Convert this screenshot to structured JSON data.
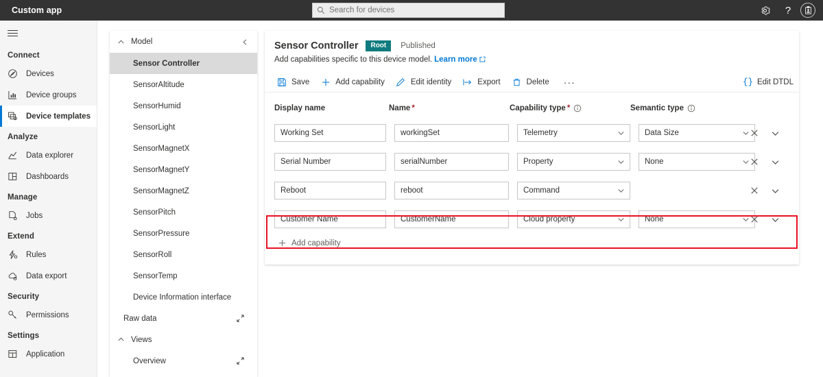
{
  "topbar": {
    "app_title": "Custom app",
    "search": {
      "placeholder": "Search for devices",
      "value": "",
      "icon": "search-icon"
    },
    "settings_icon": "gear-icon",
    "help_icon": "question-mark-icon",
    "account_icon": "account-badge-icon"
  },
  "sidebar": {
    "menu_icon": "hamburger-menu-icon",
    "groups": [
      {
        "label": "Connect",
        "items": [
          {
            "label": "Devices",
            "icon": "devices-icon",
            "selected": false
          },
          {
            "label": "Device groups",
            "icon": "device-groups-icon",
            "selected": false
          },
          {
            "label": "Device templates",
            "icon": "device-templates-icon",
            "selected": true
          }
        ]
      },
      {
        "label": "Analyze",
        "items": [
          {
            "label": "Data explorer",
            "icon": "line-chart-icon",
            "selected": false
          },
          {
            "label": "Dashboards",
            "icon": "dashboard-grid-icon",
            "selected": false
          }
        ]
      },
      {
        "label": "Manage",
        "items": [
          {
            "label": "Jobs",
            "icon": "jobs-document-icon",
            "selected": false
          }
        ]
      },
      {
        "label": "Extend",
        "items": [
          {
            "label": "Rules",
            "icon": "rules-icon",
            "selected": false
          },
          {
            "label": "Data export",
            "icon": "cloud-export-icon",
            "selected": false
          }
        ]
      },
      {
        "label": "Security",
        "items": [
          {
            "label": "Permissions",
            "icon": "key-icon",
            "selected": false
          }
        ]
      },
      {
        "label": "Settings",
        "items": [
          {
            "label": "Application",
            "icon": "application-grid-icon",
            "selected": false
          }
        ]
      }
    ]
  },
  "tree": {
    "model_header": {
      "label": "Model",
      "chevron": "chevron-up-icon",
      "collapse_icon": "chevron-left-icon"
    },
    "items": [
      {
        "label": "Sensor Controller",
        "selected": true,
        "expand": false
      },
      {
        "label": "SensorAltitude",
        "selected": false,
        "expand": false
      },
      {
        "label": "SensorHumid",
        "selected": false,
        "expand": false
      },
      {
        "label": "SensorLight",
        "selected": false,
        "expand": false
      },
      {
        "label": "SensorMagnetX",
        "selected": false,
        "expand": false
      },
      {
        "label": "SensorMagnetY",
        "selected": false,
        "expand": false
      },
      {
        "label": "SensorMagnetZ",
        "selected": false,
        "expand": false
      },
      {
        "label": "SensorPitch",
        "selected": false,
        "expand": false
      },
      {
        "label": "SensorPressure",
        "selected": false,
        "expand": false
      },
      {
        "label": "SensorRoll",
        "selected": false,
        "expand": false
      },
      {
        "label": "SensorTemp",
        "selected": false,
        "expand": false
      },
      {
        "label": "Device Information interface",
        "selected": false,
        "expand": false
      }
    ],
    "raw_data": {
      "label": "Raw data",
      "expand_icon": "expand-diagonal-icon"
    },
    "views_header": {
      "label": "Views",
      "chevron": "chevron-up-icon"
    },
    "views_items": [
      {
        "label": "Overview",
        "expand_icon": "expand-diagonal-icon"
      }
    ]
  },
  "main": {
    "title": "Sensor Controller",
    "badge": "Root",
    "status": "Published",
    "subtitle": "Add capabilities specific to this device model.",
    "learn_more": "Learn more",
    "toolbar": [
      {
        "label": "Save",
        "icon": "save-icon"
      },
      {
        "label": "Add capability",
        "icon": "plus-icon"
      },
      {
        "label": "Edit identity",
        "icon": "pencil-icon"
      },
      {
        "label": "Export",
        "icon": "export-arrow-icon"
      },
      {
        "label": "Delete",
        "icon": "trash-icon"
      }
    ],
    "overflow_label": "···",
    "edit_dtdl": {
      "label": "Edit DTDL",
      "icon": "curly-braces-icon"
    },
    "columns": [
      {
        "label": "Display name",
        "required": false,
        "info": false
      },
      {
        "label": "Name",
        "required": true,
        "info": false
      },
      {
        "label": "Capability type",
        "required": true,
        "info": true
      },
      {
        "label": "Semantic type",
        "required": false,
        "info": true
      }
    ],
    "rows": [
      {
        "display_name": "Working Set",
        "name": "workingSet",
        "capability_type": "Telemetry",
        "semantic_type": "Data Size",
        "has_semantic": true,
        "highlighted": false,
        "remove_icon": "close-x-icon",
        "expand_icon": "chevron-down-icon"
      },
      {
        "display_name": "Serial Number",
        "name": "serialNumber",
        "capability_type": "Property",
        "semantic_type": "None",
        "has_semantic": true,
        "highlighted": false,
        "remove_icon": "close-x-icon",
        "expand_icon": "chevron-down-icon"
      },
      {
        "display_name": "Reboot",
        "name": "reboot",
        "capability_type": "Command",
        "semantic_type": "",
        "has_semantic": false,
        "highlighted": false,
        "remove_icon": "close-x-icon",
        "expand_icon": "chevron-down-icon"
      },
      {
        "display_name": "Customer Name",
        "name": "CustomerName",
        "capability_type": "Cloud property",
        "semantic_type": "None",
        "has_semantic": true,
        "highlighted": true,
        "remove_icon": "close-x-icon",
        "expand_icon": "chevron-down-icon"
      }
    ],
    "add_capability": {
      "label": "Add capability",
      "icon": "plus-icon"
    }
  },
  "colors": {
    "topbar_bg": "#333333",
    "accent_blue": "#0078d4",
    "badge_teal": "#0f7b7e",
    "highlight_red": "#e81123",
    "required_red": "#a4262c",
    "nav_bg": "#f5f5f5",
    "tree_selected_bg": "#dadada"
  }
}
